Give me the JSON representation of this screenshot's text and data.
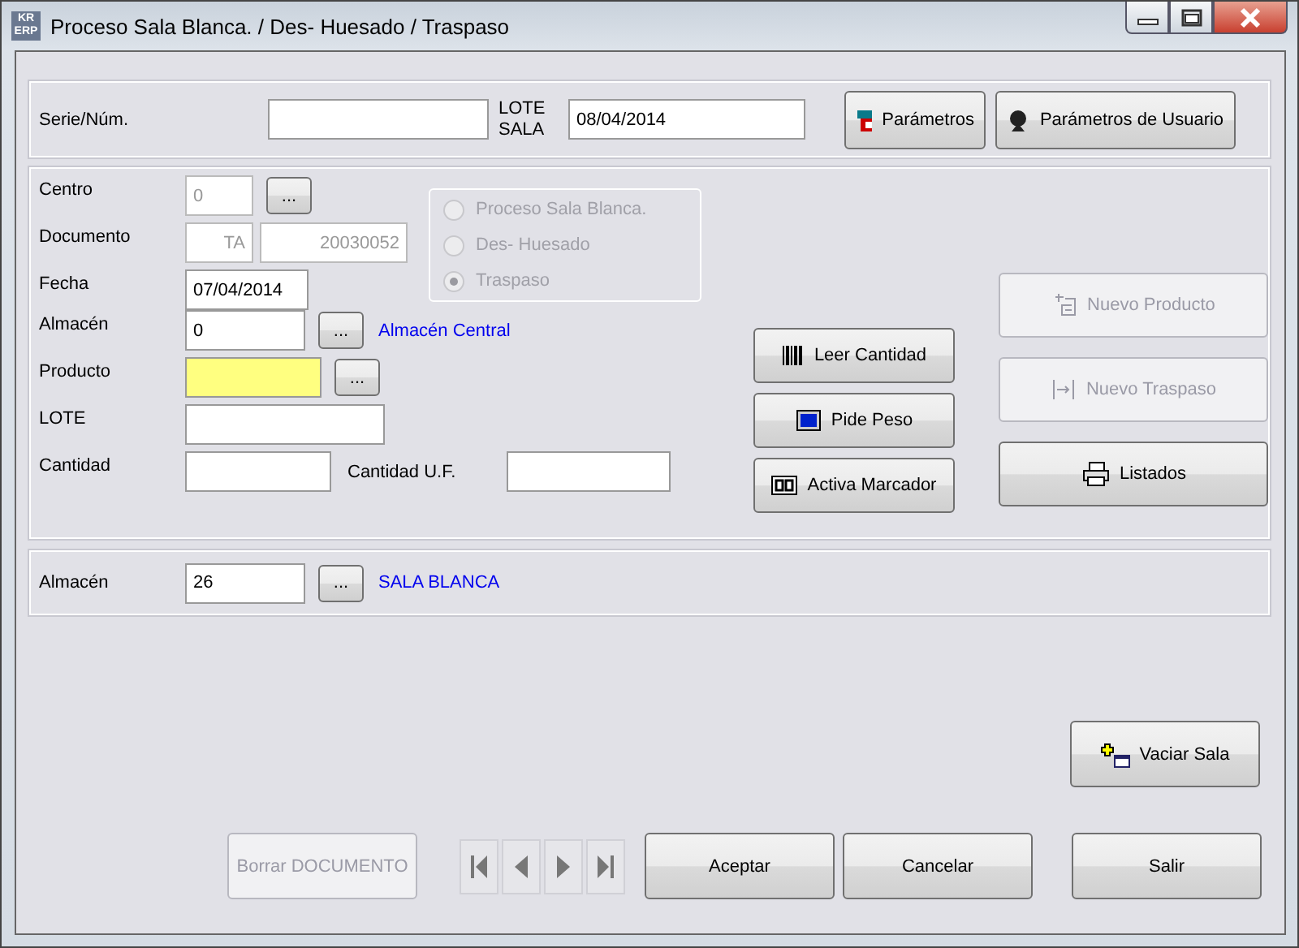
{
  "window": {
    "title": "Proceso Sala Blanca. / Des- Huesado / Traspaso",
    "logo": [
      "KR",
      "ERP"
    ]
  },
  "header": {
    "serie_label": "Serie/Núm.",
    "lote_label": "LOTE SALA",
    "lote_value": "08/04/2014",
    "buttons": [
      {
        "label": "Parámetros",
        "kind": "params"
      },
      {
        "label": "Parámetros de Usuario",
        "kind": "user"
      }
    ]
  },
  "fields": [
    {
      "kind": "lookup",
      "label": "Centro",
      "value": "0",
      "disabled": true,
      "button": "..."
    },
    {
      "kind": "document",
      "label": "Documento",
      "series": "TA",
      "number": "20030052",
      "disabled": true
    },
    {
      "kind": "text",
      "label": "Fecha",
      "value": "07/04/2014"
    },
    {
      "kind": "lookup",
      "label": "Almacén",
      "value": "0",
      "description": "Almacén Central",
      "button": "..."
    },
    {
      "kind": "lookup",
      "label": "Producto",
      "highlighted": true,
      "button": "..."
    },
    {
      "kind": "long_text",
      "label": "LOTE"
    },
    {
      "kind": "pair",
      "label": "Cantidad",
      "second_label": "Cantidad U.F."
    }
  ],
  "process_options": [
    {
      "label": "Proceso Sala Blanca.",
      "selected": false
    },
    {
      "label": "Des- Huesado",
      "selected": false
    },
    {
      "label": "Traspaso",
      "selected": true
    }
  ],
  "process_disabled": true,
  "scale_buttons": [
    {
      "label": "Leer Cantidad",
      "kind": "barcode"
    },
    {
      "label": "Pide Peso",
      "kind": "monitor"
    },
    {
      "label": "Activa Marcador",
      "kind": "counter"
    }
  ],
  "action_buttons": [
    {
      "label": "Nuevo Producto",
      "kind": "new",
      "disabled": true
    },
    {
      "label": "Nuevo Traspaso",
      "kind": "transfer",
      "disabled": true
    },
    {
      "label": "Listados",
      "kind": "print",
      "disabled": false
    }
  ],
  "destination": {
    "label": "Almacén",
    "value": "26",
    "description": "SALA BLANCA",
    "button": "..."
  },
  "vaciar": {
    "label": "Vaciar Sala"
  },
  "footer": {
    "delete_label": "Borrar DOCUMENTO",
    "delete_disabled": true,
    "buttons": [
      "Aceptar",
      "Cancelar"
    ],
    "exit": "Salir"
  }
}
